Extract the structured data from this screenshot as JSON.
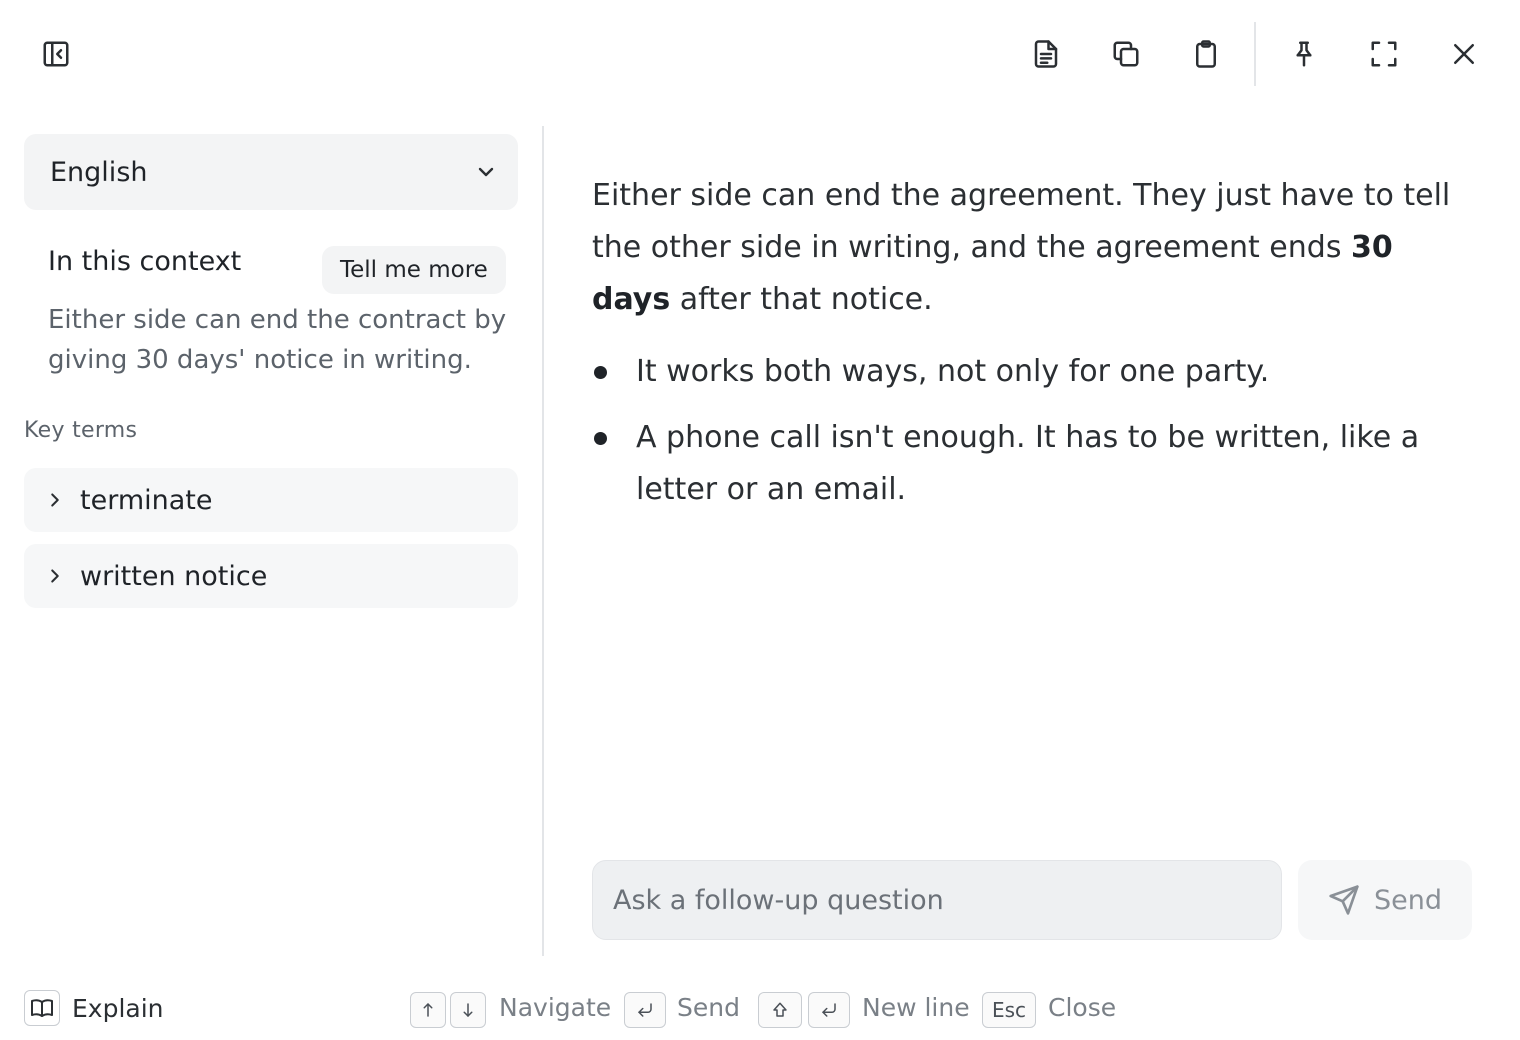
{
  "toolbar": {
    "collapse_icon": "sidebar-collapse-icon",
    "icons": [
      "document-icon",
      "copy-icon",
      "clipboard-icon",
      "pin-icon",
      "fullscreen-icon",
      "close-icon"
    ]
  },
  "language": {
    "selected": "English",
    "icon": "chevron-down-icon"
  },
  "context": {
    "heading": "In this context",
    "tell_more_label": "Tell me more",
    "summary": "Either side can end the contract by giving 30 days' notice in writing."
  },
  "key_terms": {
    "heading": "Key terms",
    "items": [
      {
        "label": "terminate"
      },
      {
        "label": "written notice"
      }
    ]
  },
  "answer": {
    "intro_before": "Either side can end the agreement. They just have to tell the other side in writing, and the agreement ends ",
    "intro_bold": "30 days",
    "intro_after": " after that notice.",
    "bullets": [
      "It works both ways, not only for one party.",
      "A phone call isn't enough. It has to be written, like a letter or an email."
    ]
  },
  "followup": {
    "placeholder": "Ask a follow-up question",
    "value": "",
    "send_label": "Send"
  },
  "footer": {
    "mode_label": "Explain",
    "navigate_label": "Navigate",
    "send_label": "Send",
    "newline_label": "New line",
    "esc_key": "Esc",
    "close_label": "Close"
  },
  "colors": {
    "background": "#ffffff",
    "panel": "#f3f4f5",
    "text": "#1f2328",
    "muted": "#5c636b",
    "divider": "#e3e5e8"
  }
}
